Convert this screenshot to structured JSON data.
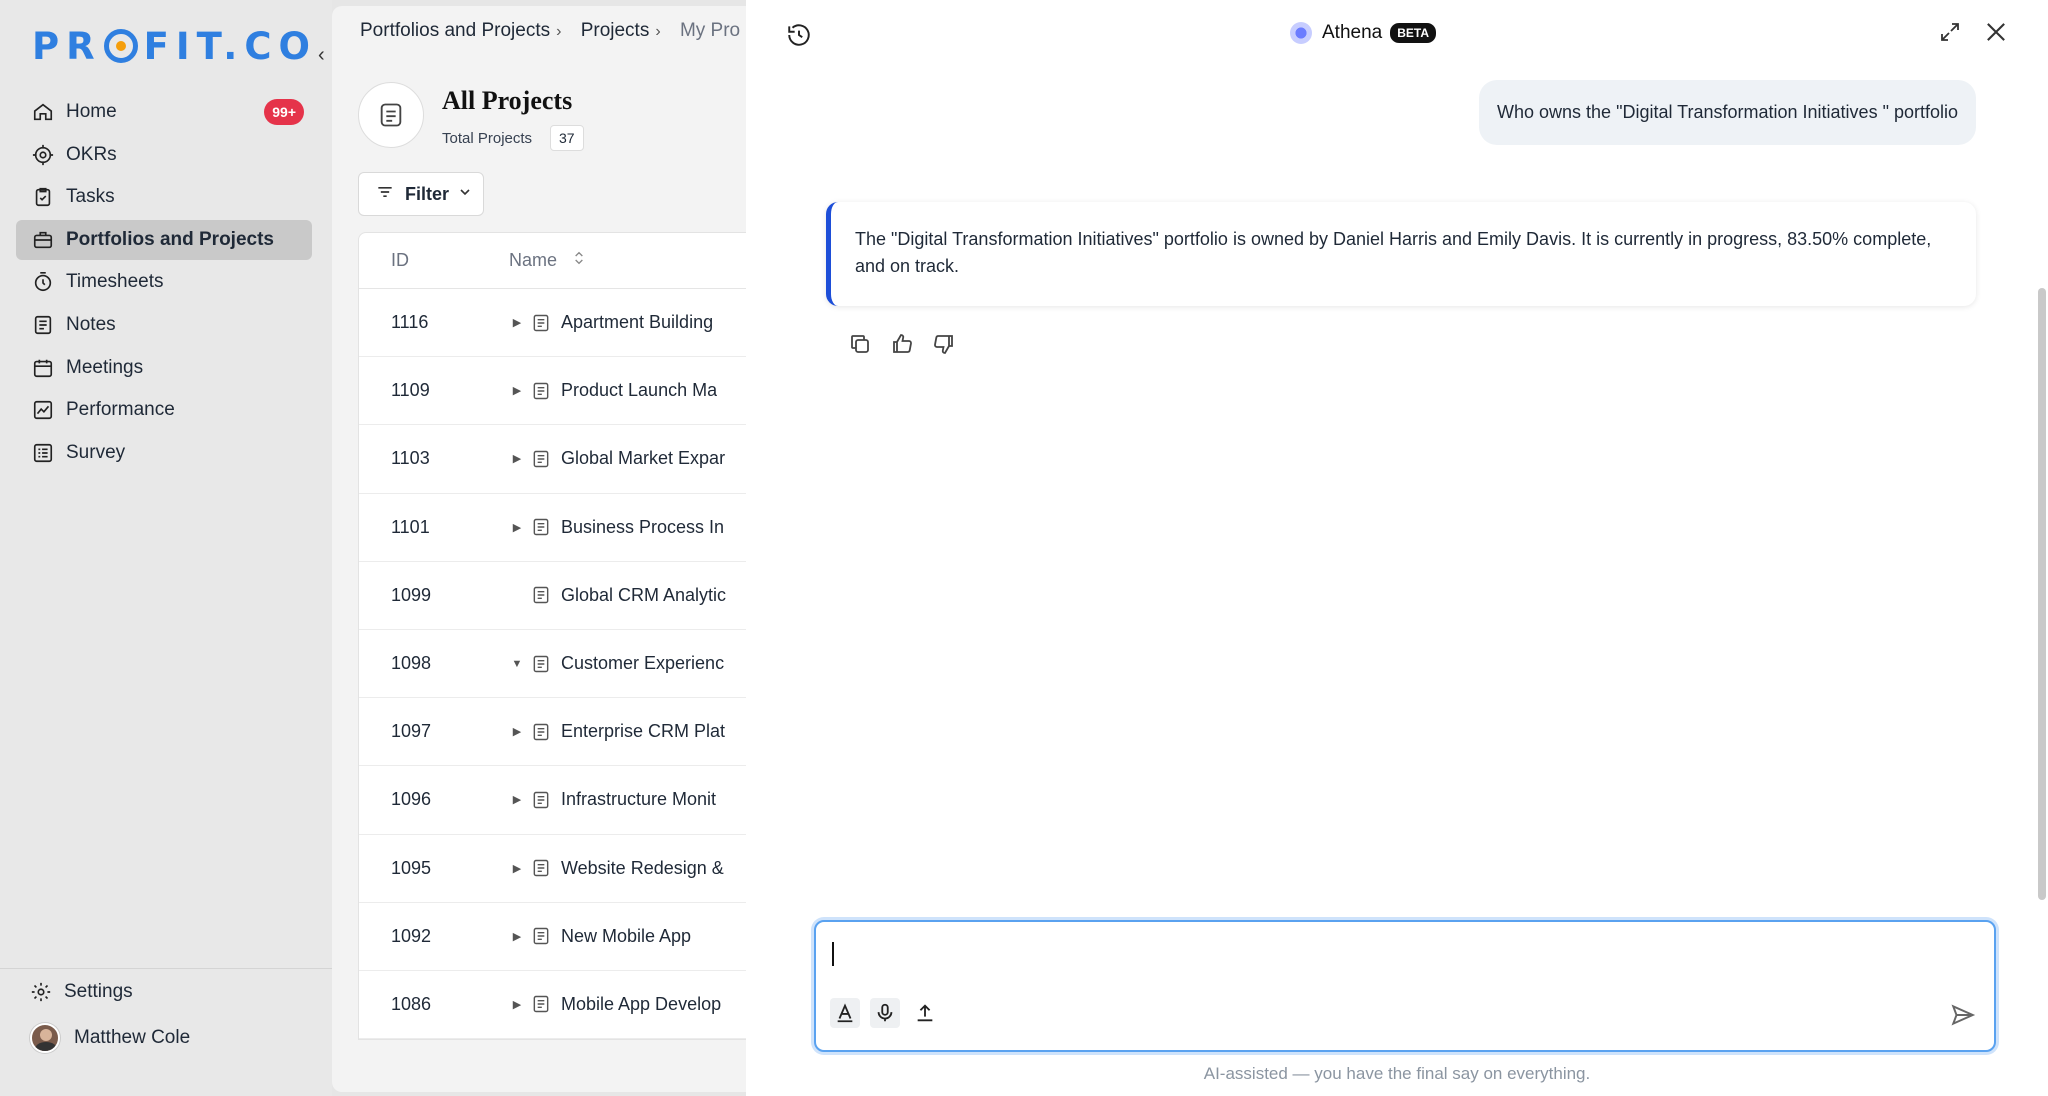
{
  "brand": {
    "logo_text": "PROFIT.CO"
  },
  "sidebar": {
    "items": [
      {
        "label": "Home",
        "icon": "home-icon",
        "badge": "99+"
      },
      {
        "label": "OKRs",
        "icon": "target-icon"
      },
      {
        "label": "Tasks",
        "icon": "clipboard-check-icon"
      },
      {
        "label": "Portfolios and Projects",
        "icon": "briefcase-icon",
        "active": true
      },
      {
        "label": "Timesheets",
        "icon": "stopwatch-icon"
      },
      {
        "label": "Notes",
        "icon": "note-icon"
      },
      {
        "label": "Meetings",
        "icon": "calendar-icon"
      },
      {
        "label": "Performance",
        "icon": "chart-line-icon"
      },
      {
        "label": "Survey",
        "icon": "survey-list-icon"
      }
    ],
    "settings_label": "Settings",
    "user_name": "Matthew Cole"
  },
  "main": {
    "breadcrumb": [
      "Portfolios and Projects",
      "Projects",
      "My Pro"
    ],
    "title": "All Projects",
    "total_label": "Total Projects",
    "total_value": "37",
    "filter_label": "Filter",
    "columns": {
      "id": "ID",
      "name": "Name"
    },
    "rows": [
      {
        "id": "1116",
        "name": "Apartment Building",
        "expand": "collapsed"
      },
      {
        "id": "1109",
        "name": "Product Launch Ma",
        "expand": "collapsed"
      },
      {
        "id": "1103",
        "name": "Global Market Expar",
        "expand": "collapsed"
      },
      {
        "id": "1101",
        "name": "Business Process In",
        "expand": "collapsed"
      },
      {
        "id": "1099",
        "name": "Global CRM Analytic",
        "expand": "none"
      },
      {
        "id": "1098",
        "name": "Customer Experienc",
        "expand": "expanded"
      },
      {
        "id": "1097",
        "name": "Enterprise CRM Plat",
        "expand": "collapsed"
      },
      {
        "id": "1096",
        "name": "Infrastructure Monit",
        "expand": "collapsed"
      },
      {
        "id": "1095",
        "name": "Website Redesign &",
        "expand": "collapsed"
      },
      {
        "id": "1092",
        "name": "New Mobile App",
        "expand": "collapsed"
      },
      {
        "id": "1086",
        "name": "Mobile App Develop",
        "expand": "collapsed"
      }
    ]
  },
  "chat": {
    "title": "Athena",
    "badge": "BETA",
    "user_message": "Who owns the \"Digital Transformation Initiatives \" portfolio",
    "ai_message": "The \"Digital Transformation Initiatives\" portfolio is owned by Daniel Harris and Emily Davis. It is currently in progress, 83.50% complete, and on track.",
    "input_value": "",
    "disclaimer": "AI-assisted — you have the final say on everything."
  },
  "colors": {
    "brand": "#2f7fe0",
    "badge": "#e5334a",
    "ai_accent": "#1d4ed8",
    "input_focus": "#5aa2f0"
  }
}
